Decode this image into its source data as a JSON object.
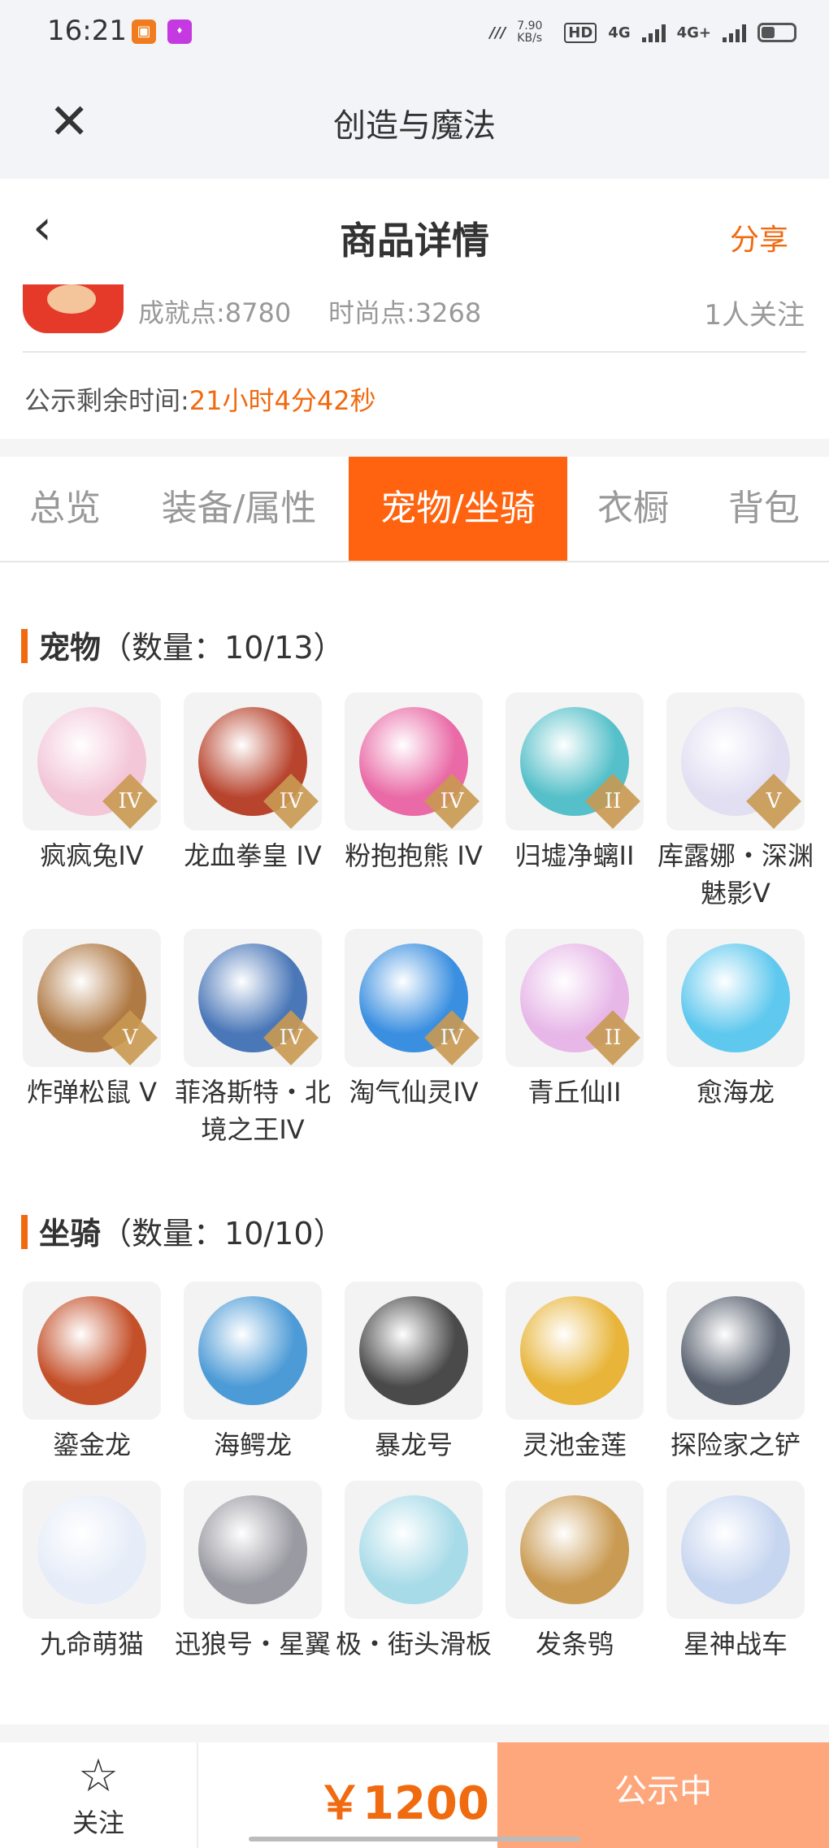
{
  "status_bar": {
    "time": "16:21",
    "net_speed": "7.90 KB/s",
    "net1": "4G",
    "net2": "4G+"
  },
  "window": {
    "title": "创造与魔法"
  },
  "header": {
    "title": "商品详情",
    "share": "分享"
  },
  "stats": {
    "achievement": "成就点:8780",
    "fashion": "时尚点:3268",
    "followers": "1人关注"
  },
  "notice": {
    "label": "公示剩余时间:",
    "value": "21小时4分42秒"
  },
  "tabs": [
    {
      "label": "总览"
    },
    {
      "label": "装备/属性"
    },
    {
      "label": "宠物/坐骑",
      "active": true
    },
    {
      "label": "衣橱"
    },
    {
      "label": "背包"
    }
  ],
  "pets": {
    "title": "宠物",
    "count": "（数量：10/13）",
    "items": [
      {
        "name": "疯疯兔IV",
        "badge": "IV",
        "color": "#f3c6d8"
      },
      {
        "name": "龙血拳皇 IV",
        "badge": "IV",
        "color": "#b8442e"
      },
      {
        "name": "粉抱抱熊 IV",
        "badge": "IV",
        "color": "#e96aa6"
      },
      {
        "name": "归墟净螭II",
        "badge": "II",
        "color": "#55c0c9"
      },
      {
        "name": "库露娜・深渊魅影V",
        "badge": "V",
        "color": "#e2dff2"
      },
      {
        "name": "炸弹松鼠 V",
        "badge": "V",
        "color": "#b07a45"
      },
      {
        "name": "菲洛斯特・北境之王IV",
        "badge": "IV",
        "color": "#4a77b8"
      },
      {
        "name": "淘气仙灵IV",
        "badge": "IV",
        "color": "#3a8fe0"
      },
      {
        "name": "青丘仙II",
        "badge": "II",
        "color": "#e7b7e8"
      },
      {
        "name": "愈海龙",
        "badge": "",
        "color": "#5ec8ee"
      }
    ]
  },
  "mounts": {
    "title": "坐骑",
    "count": "（数量：10/10）",
    "items": [
      {
        "name": "鎏金龙",
        "color": "#c4502a"
      },
      {
        "name": "海鳄龙",
        "color": "#4d9bd6"
      },
      {
        "name": "暴龙号",
        "color": "#4a4a4a"
      },
      {
        "name": "灵池金莲",
        "color": "#e8b53a"
      },
      {
        "name": "探险家之铲",
        "color": "#5a6270"
      },
      {
        "name": "九命萌猫",
        "color": "#e6ecf8"
      },
      {
        "name": "迅狼号・星翼",
        "color": "#9a9aa2"
      },
      {
        "name": "极・街头滑板",
        "color": "#a8dbe8"
      },
      {
        "name": "发条鸮",
        "color": "#c99a52"
      },
      {
        "name": "星神战车",
        "color": "#c7d6f0"
      }
    ]
  },
  "bottom": {
    "follow": "关注",
    "price": "￥1200",
    "status": "公示中"
  }
}
